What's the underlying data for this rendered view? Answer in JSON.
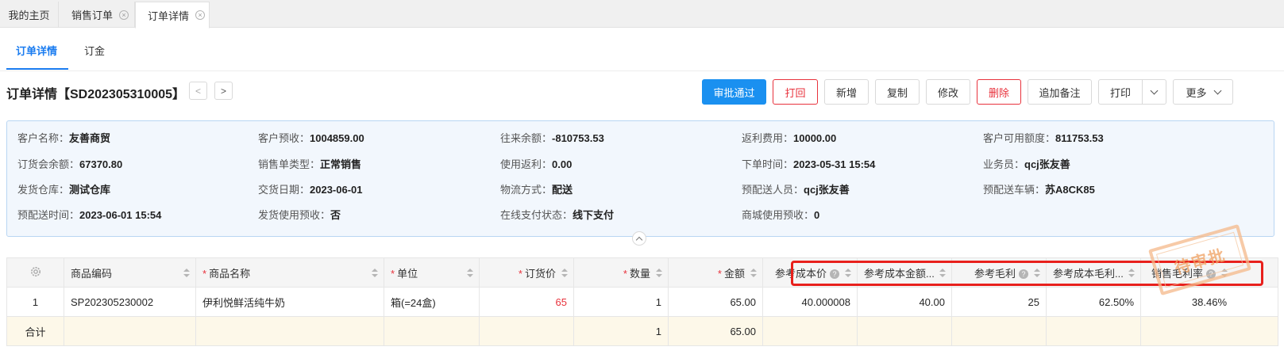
{
  "tabstrip": {
    "tabs": [
      {
        "label": "我的主页",
        "closable": false,
        "active": false
      },
      {
        "label": "销售订单",
        "closable": true,
        "active": false
      },
      {
        "label": "订单详情",
        "closable": true,
        "active": true
      }
    ],
    "close_glyph": "×"
  },
  "subtabs": [
    {
      "label": "订单详情",
      "active": true
    },
    {
      "label": "订金",
      "active": false
    }
  ],
  "header": {
    "title": "订单详情【SD202305310005】",
    "prev_glyph": "<",
    "next_glyph": ">"
  },
  "toolbar": {
    "approve": "审批通过",
    "reject": "打回",
    "add": "新增",
    "copy": "复制",
    "edit": "修改",
    "delete": "删除",
    "append_note": "追加备注",
    "print": "打印",
    "more": "更多"
  },
  "info": {
    "customer_name": {
      "label": "客户名称：",
      "value": "友善商贸"
    },
    "customer_prepay": {
      "label": "客户预收：",
      "value": "1004859.00"
    },
    "balance": {
      "label": "往来余额：",
      "value": "-810753.53"
    },
    "rebate_fee": {
      "label": "返利费用：",
      "value": "10000.00"
    },
    "available_credit": {
      "label": "客户可用额度：",
      "value": "811753.53"
    },
    "order_meeting_balance": {
      "label": "订货会余额：",
      "value": "67370.80"
    },
    "sales_type": {
      "label": "销售单类型：",
      "value": "正常销售"
    },
    "use_rebate": {
      "label": "使用返利：",
      "value": "0.00"
    },
    "order_time": {
      "label": "下单时间：",
      "value": "2023-05-31 15:54"
    },
    "salesperson": {
      "label": "业务员：",
      "value": "qcj张友善"
    },
    "warehouse": {
      "label": "发货仓库：",
      "value": "测试仓库"
    },
    "delivery_date": {
      "label": "交货日期：",
      "value": "2023-06-01"
    },
    "logistics": {
      "label": "物流方式：",
      "value": "配送"
    },
    "delivery_person": {
      "label": "预配送人员：",
      "value": "qcj张友善"
    },
    "delivery_vehicle": {
      "label": "预配送车辆：",
      "value": "苏A8CK85"
    },
    "delivery_time": {
      "label": "预配送时间：",
      "value": "2023-06-01 15:54"
    },
    "ship_use_prepay": {
      "label": "发货使用预收：",
      "value": "否"
    },
    "online_pay_status": {
      "label": "在线支付状态：",
      "value": "线下支付"
    },
    "mall_use_prepay": {
      "label": "商城使用预收：",
      "value": "0"
    }
  },
  "table": {
    "columns": {
      "sku_code": "商品编码",
      "name": "商品名称",
      "unit": "单位",
      "price": "订货价",
      "qty": "数量",
      "amount": "金额",
      "ref_cost": "参考成本价",
      "ref_cost_amount": "参考成本金额...",
      "ref_margin": "参考毛利",
      "ref_margin_rate": "参考成本毛利...",
      "sales_margin_rate": "销售毛利率"
    },
    "required_mark": "*",
    "help_glyph": "?",
    "rows": [
      {
        "index": "1",
        "sku_code": "SP202305230002",
        "name": "伊利悦鲜活纯牛奶",
        "unit": "箱(=24盒)",
        "price": "65",
        "qty": "1",
        "amount": "65.00",
        "ref_cost": "40.000008",
        "ref_cost_amount": "40.00",
        "ref_margin": "25",
        "ref_margin_rate": "62.50%",
        "sales_margin_rate": "38.46%"
      }
    ],
    "total": {
      "label": "合计",
      "qty": "1",
      "amount": "65.00"
    }
  },
  "stamp": {
    "text": "待审批"
  },
  "colors": {
    "accent": "#1a90f0",
    "danger": "#e8323c",
    "highlight": "#e8201c",
    "info_bg": "#f2f7fd",
    "total_row_bg": "#fdf8e9"
  }
}
